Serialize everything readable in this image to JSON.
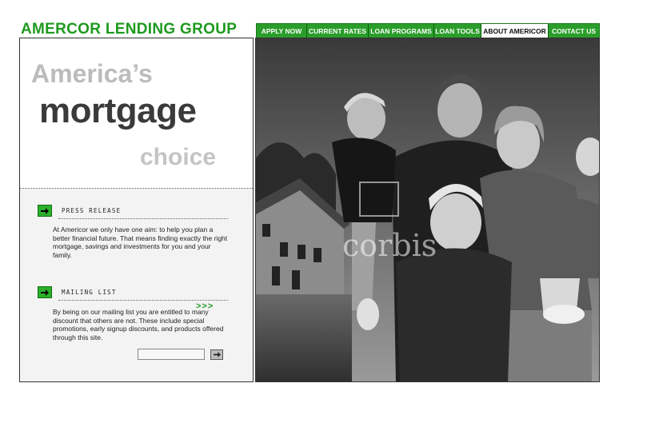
{
  "brand": {
    "name": "AMERCOR LENDING GROUP",
    "accent": "#1e9a1e"
  },
  "nav": {
    "items": [
      {
        "label": "APPLY NOW"
      },
      {
        "label": "CURRENT RATES"
      },
      {
        "label": "LOAN PROGRAMS"
      },
      {
        "label": "LOAN TOOLS"
      },
      {
        "label": "ABOUT AMERICOR"
      },
      {
        "label": "CONTACT US"
      }
    ],
    "active_index": 4
  },
  "hero": {
    "line1": "America’s",
    "line2": "mortgage",
    "line3": "choice"
  },
  "press_release": {
    "title": "PRESS RELEASE",
    "text": "At Americor we only have one aim: to help you plan a better financial future. That means finding exactly the right mortgage, savings and investments for you and your family.",
    "more_label": ">>>",
    "icon": "arrow-right-icon"
  },
  "mailing_list": {
    "title": "MAILING LIST",
    "text": "By being on our mailing list you are entitled to many discount that others are not. These include special promotions, early signup discounts, and products offered through this site.",
    "input_value": "",
    "submit_icon": "arrow-right-icon"
  },
  "photo": {
    "watermark": "corbis",
    "description_icon": "family-photo"
  }
}
